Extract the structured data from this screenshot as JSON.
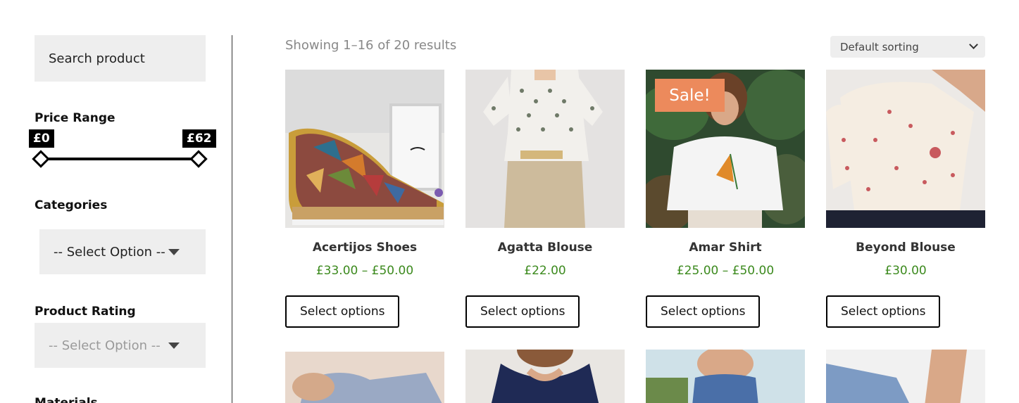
{
  "sidebar": {
    "search": {
      "placeholder": "Search product"
    },
    "price_range": {
      "title": "Price Range",
      "min_label": "£0",
      "max_label": "£62"
    },
    "categories": {
      "title": "Categories",
      "selected": "-- Select Option --"
    },
    "product_rating": {
      "title": "Product Rating",
      "selected": "-- Select Option --"
    },
    "next_section_title": "Materials"
  },
  "main": {
    "result_count": "Showing 1–16 of 20 results",
    "sorting": {
      "selected": "Default sorting"
    },
    "products": [
      {
        "name": "Acertijos Shoes",
        "price": "£33.00 – £50.00",
        "button": "Select options",
        "sale": ""
      },
      {
        "name": "Agatta Blouse",
        "price": "£22.00",
        "button": "Select options",
        "sale": ""
      },
      {
        "name": "Amar Shirt",
        "price": "£25.00 – £50.00",
        "button": "Select options",
        "sale": "Sale!"
      },
      {
        "name": "Beyond Blouse",
        "price": "£30.00",
        "button": "Select options",
        "sale": ""
      }
    ]
  },
  "colors": {
    "accent_sale": "#ec8a5c",
    "price": "#3c8a1e"
  }
}
